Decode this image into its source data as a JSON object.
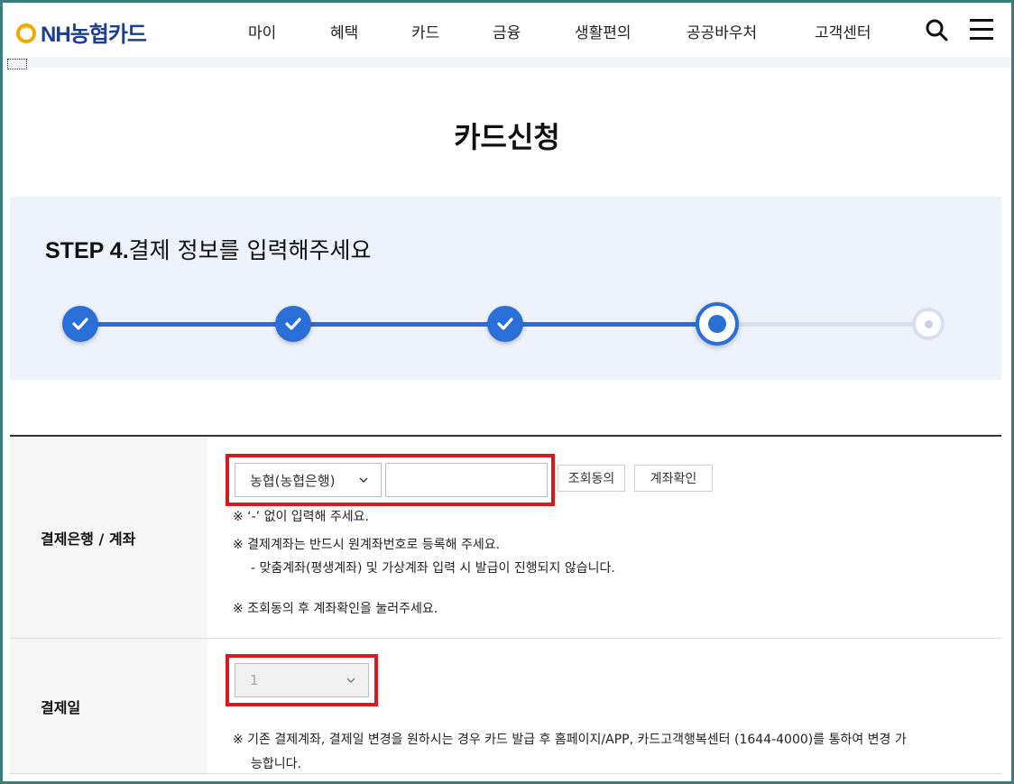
{
  "header": {
    "logo_text": "NH농협카드",
    "nav": [
      "마이",
      "혜택",
      "카드",
      "금융",
      "생활편의",
      "공공바우처",
      "고객센터"
    ]
  },
  "page_title": "카드신청",
  "step": {
    "label": "STEP 4.",
    "title": "결제 정보를 입력해주세요",
    "total_steps": 5,
    "current_step": 4
  },
  "form": {
    "bank_account": {
      "label": "결제은행 / 계좌",
      "bank_selected": "농협(농협은행)",
      "account_value": "",
      "inquiry_consent_button": "조회동의",
      "account_check_button": "계좌확인",
      "notes": [
        "※  ‘-’ 없이 입력해 주세요.",
        "※  결제계좌는 반드시 원계좌번호로 등록해 주세요.",
        "- 맞춤계좌(평생계좌) 및 가상계좌 입력 시 발급이 진행되지 않습니다.",
        "※ 조회동의 후 계좌확인을 눌러주세요."
      ]
    },
    "payment_day": {
      "label": "결제일",
      "selected": "1",
      "notes": [
        "※  기존 결제계좌, 결제일 변경을 원하시는 경우 카드 발급 후 홈페이지/APP, 카드고객행복센터 (1644-4000)를 통하여 변경 가",
        "능합니다."
      ]
    }
  },
  "colors": {
    "accent": "#2a6fd8",
    "highlight_border": "#d61a20",
    "logo": "#1d3f8f"
  }
}
